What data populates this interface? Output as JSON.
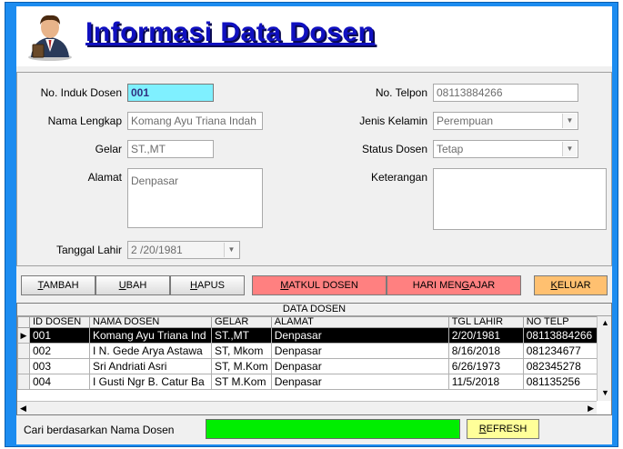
{
  "header": {
    "title": "Informasi Data Dosen"
  },
  "form": {
    "nip_label": "No. Induk Dosen",
    "nip_value": "001",
    "nama_label": "Nama Lengkap",
    "nama_value": "Komang Ayu Triana Indah",
    "gelar_label": "Gelar",
    "gelar_value": "ST.,MT",
    "alamat_label": "Alamat",
    "alamat_value": "Denpasar",
    "tgl_label": "Tanggal Lahir",
    "tgl_value": "2 /20/1981",
    "telp_label": "No. Telpon",
    "telp_value": "08113884266",
    "jk_label": "Jenis Kelamin",
    "jk_value": "Perempuan",
    "status_label": "Status Dosen",
    "status_value": "Tetap",
    "ket_label": "Keterangan",
    "ket_value": ""
  },
  "buttons": {
    "tambah": {
      "u": "T",
      "rest": "AMBAH"
    },
    "ubah": {
      "u": "U",
      "rest": "BAH"
    },
    "hapus": {
      "u": "H",
      "rest": "APUS"
    },
    "matkul": {
      "u": "M",
      "rest": "ATKUL DOSEN"
    },
    "hari": {
      "pre": "HARI MEN",
      "u": "G",
      "rest": "AJAR"
    },
    "keluar": {
      "u": "K",
      "rest": "ELUAR"
    },
    "refresh": {
      "u": "R",
      "rest": "EFRESH"
    }
  },
  "grid": {
    "caption": "DATA DOSEN",
    "columns": [
      "ID DOSEN",
      "NAMA DOSEN",
      "GELAR",
      "ALAMAT",
      "TGL LAHIR",
      "NO TELP"
    ],
    "rows": [
      [
        "001",
        "Komang Ayu Triana Ind",
        "ST.,MT",
        "Denpasar",
        "2/20/1981",
        "08113884266"
      ],
      [
        "002",
        "I N. Gede Arya Astawa",
        "ST, Mkom",
        "Denpasar",
        "8/16/2018",
        "081234677"
      ],
      [
        "003",
        "Sri Andriati Asri",
        "ST, M.Kom",
        "Denpasar",
        "6/26/1973",
        "082345278"
      ],
      [
        "004",
        "I Gusti Ngr B. Catur Ba",
        "ST M.Kom",
        "Denpasar",
        "11/5/2018",
        "081135256"
      ]
    ]
  },
  "search": {
    "label": "Cari berdasarkan Nama Dosen",
    "value": ""
  },
  "colors": {
    "frame": "#1c8cf0",
    "active_field": "#7ff0ff",
    "matkul_button": "#ff8080",
    "hari_button": "#ff8080",
    "keluar_button": "#ffc070",
    "refresh_button": "#ffff99",
    "search_box": "#00ee00",
    "title": "#1010c0"
  },
  "icons": {
    "logo": "lecturer-avatar-icon"
  }
}
